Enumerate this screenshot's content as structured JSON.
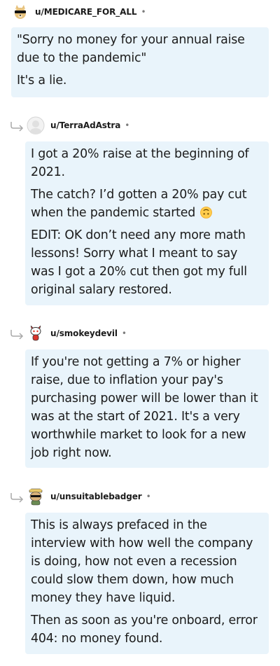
{
  "comments": [
    {
      "username": "u/MEDICARE_FOR_ALL",
      "separator": "•",
      "avatar_icon": "doge-sunglasses-avatar-icon",
      "paragraphs": [
        "\"Sorry no money for your annual raise due to the pandemic\"",
        "It's a lie."
      ]
    },
    {
      "username": "u/TerraAdAstra",
      "separator": "•",
      "avatar_icon": "default-gray-avatar-icon",
      "reply_icon": "reply-arrow-icon",
      "paragraphs": [
        "I got a 20% raise at the beginning of 2021.",
        "The catch? I’d gotten a 20% pay cut when the pandemic started",
        "EDIT: OK don’t need any more math lessons! Sorry what I meant to say was I got a 20% cut then got my full original salary restored."
      ],
      "emoji_icon": "upside-down-face-emoji-icon"
    },
    {
      "username": "u/smokeydevil",
      "separator": "•",
      "avatar_icon": "snoo-red-devil-avatar-icon",
      "reply_icon": "reply-arrow-icon",
      "paragraphs": [
        "If you're not getting a 7% or higher raise, due to inflation your pay's purchasing power will be lower than it was at the start of 2021. It's a very worthwhile market to look for a new job right now."
      ]
    },
    {
      "username": "u/unsuitablebadger",
      "separator": "•",
      "avatar_icon": "badger-avatar-icon",
      "reply_icon": "reply-arrow-icon",
      "paragraphs": [
        "This is always prefaced in the interview with how well the company is doing, how not even a recession could slow them down, how much money they have liquid.",
        "Then as soon as you're onboard, error 404: no money found."
      ]
    }
  ],
  "colors": {
    "bubble": "#e9f4fb",
    "text": "#1c1c1c",
    "meta": "#7c7c7c"
  }
}
